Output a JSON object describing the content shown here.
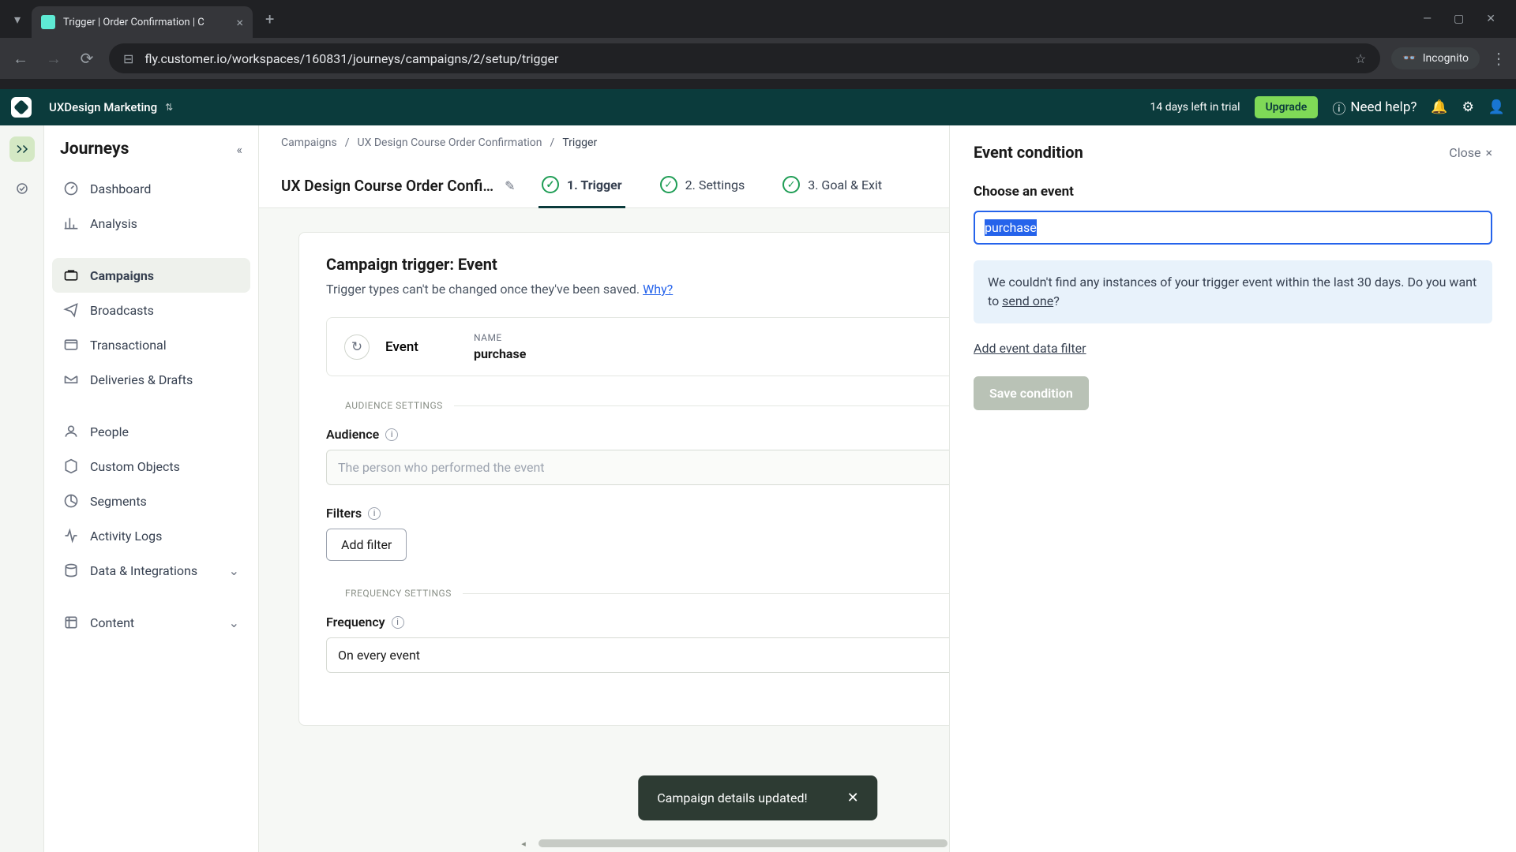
{
  "browser": {
    "tab_title": "Trigger | Order Confirmation | C",
    "url": "fly.customer.io/workspaces/160831/journeys/campaigns/2/setup/trigger",
    "incognito": "Incognito"
  },
  "header": {
    "workspace": "UXDesign Marketing",
    "trial": "14 days left in trial",
    "upgrade": "Upgrade",
    "help": "Need help?"
  },
  "sidebar": {
    "title": "Journeys",
    "items": [
      {
        "label": "Dashboard"
      },
      {
        "label": "Analysis"
      },
      {
        "label": "Campaigns"
      },
      {
        "label": "Broadcasts"
      },
      {
        "label": "Transactional"
      },
      {
        "label": "Deliveries & Drafts"
      },
      {
        "label": "People"
      },
      {
        "label": "Custom Objects"
      },
      {
        "label": "Segments"
      },
      {
        "label": "Activity Logs"
      },
      {
        "label": "Data & Integrations"
      },
      {
        "label": "Content"
      }
    ]
  },
  "breadcrumbs": {
    "a": "Campaigns",
    "b": "UX Design Course Order Confirmation",
    "c": "Trigger"
  },
  "page": {
    "title": "UX Design Course Order Confi…",
    "steps": {
      "s1": "1. Trigger",
      "s2": "2. Settings",
      "s3": "3. Goal & Exit"
    }
  },
  "trigger": {
    "heading": "Campaign trigger: Event",
    "sub": "Trigger types can't be changed once they've been saved. ",
    "why": "Why?",
    "event_label": "Event",
    "name_label": "NAME",
    "name_value": "purchase",
    "audience_section": "AUDIENCE SETTINGS",
    "audience_label": "Audience",
    "audience_placeholder": "The person who performed the event",
    "filters_label": "Filters",
    "add_filter": "Add filter",
    "frequency_section": "FREQUENCY SETTINGS",
    "frequency_label": "Frequency",
    "frequency_value": "On every event"
  },
  "panel": {
    "title": "Event condition",
    "close": "Close",
    "choose_label": "Choose an event",
    "input_value": "purchase",
    "info_a": "We couldn't find any instances of your trigger event within the last 30 days. Do you want to ",
    "info_link": "send one",
    "info_b": "?",
    "add_filter": "Add event data filter",
    "save": "Save condition"
  },
  "toast": {
    "message": "Campaign details updated!"
  }
}
